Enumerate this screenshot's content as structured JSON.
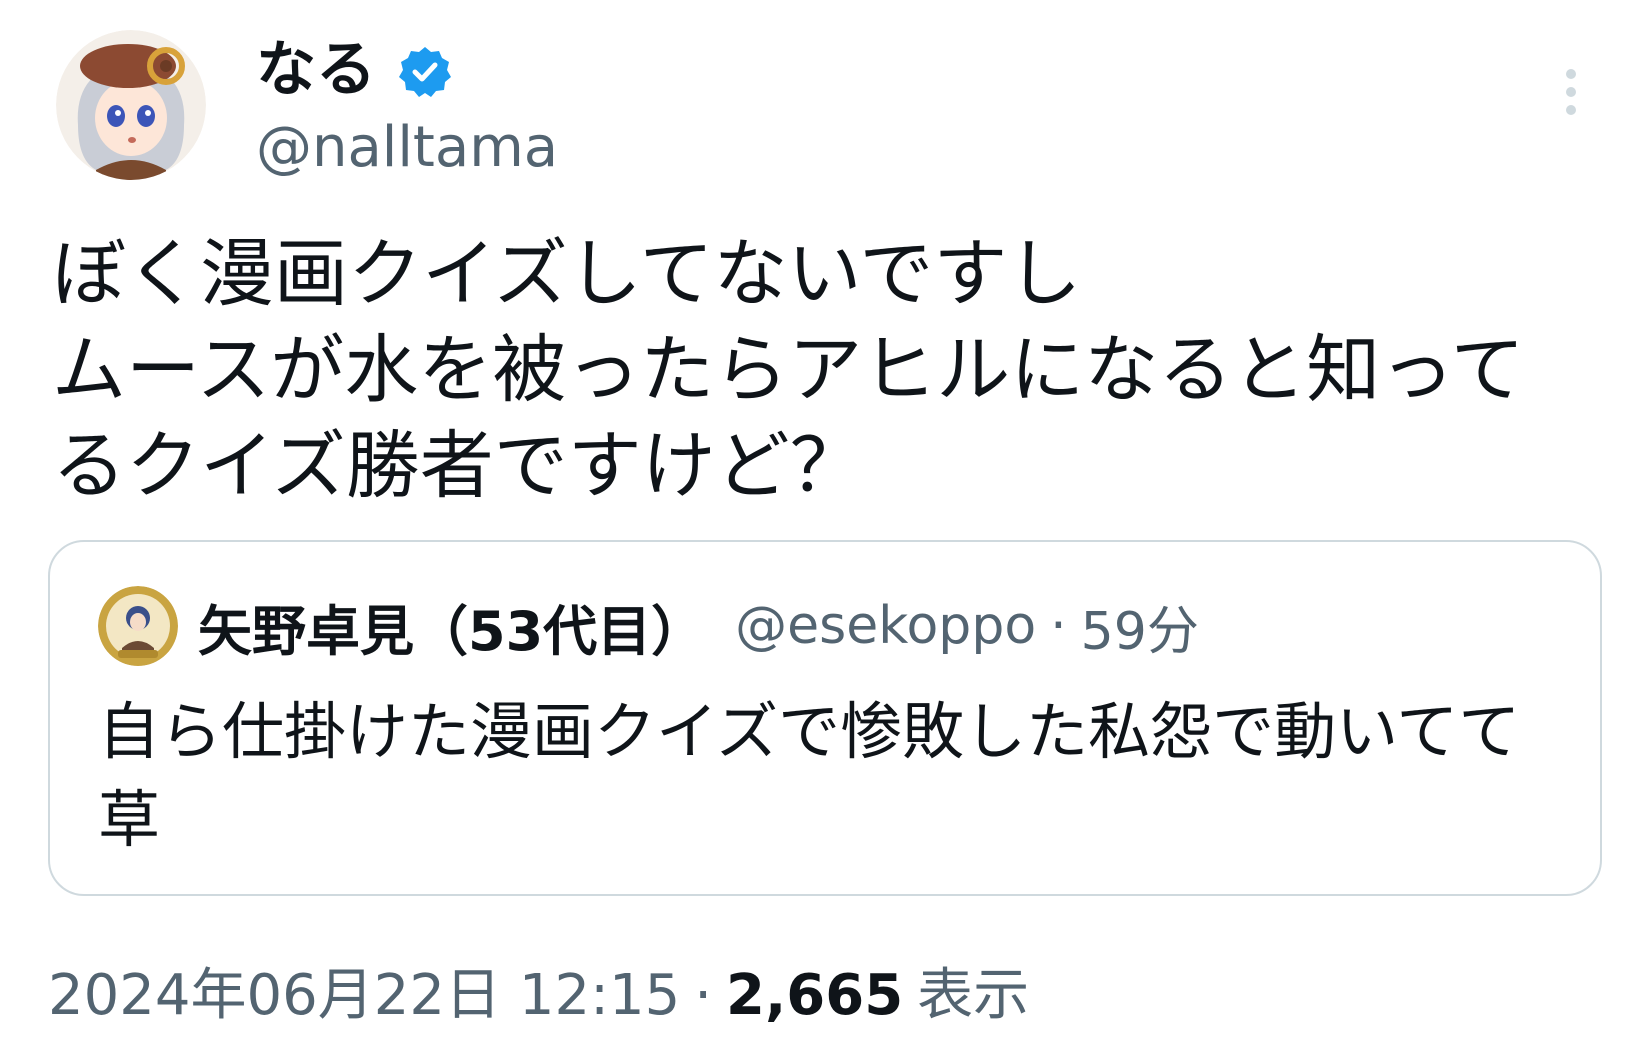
{
  "author": {
    "display_name": "なる",
    "handle": "@nalltama",
    "verified": true,
    "avatar_icon": "anime-girl-avatar"
  },
  "tweet": {
    "lines": [
      "ぼく漫画クイズしてないですし",
      "ムースが水を被ったらアヒルになると知って",
      "るクイズ勝者ですけど？"
    ]
  },
  "quote": {
    "display_name": "矢野卓見（53代目）",
    "handle": "@esekoppo",
    "separator": "·",
    "time": "59分",
    "lines": [
      "自ら仕掛けた漫画クイズで惨敗した私怨で動いてて",
      "草"
    ],
    "avatar_icon": "gold-badge-avatar"
  },
  "meta": {
    "date": "2024年06月22日 12:15",
    "separator": "·",
    "views_count": "2,665",
    "views_label": "表示"
  },
  "colors": {
    "text_primary": "#0f1419",
    "text_secondary": "#536471",
    "verified_blue": "#1d9bf0",
    "border": "#cfd9de"
  },
  "icons": {
    "more": "more-vertical-icon",
    "verified": "verified-badge-icon"
  }
}
